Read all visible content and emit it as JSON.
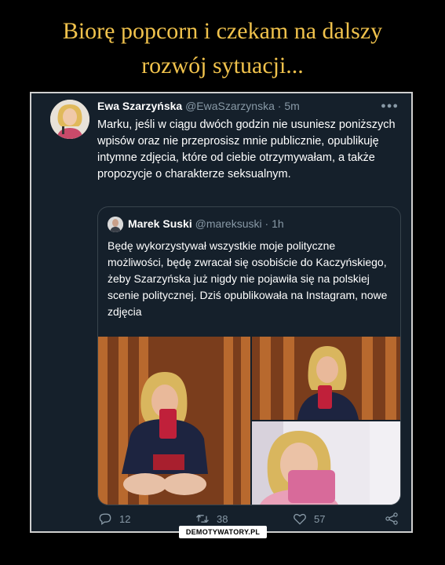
{
  "meme": {
    "title_line1": "Biorę popcorn i czekam na dalszy",
    "title_line2": "rozwój sytuacji...",
    "watermark": "DEMOTYWATORY.PL"
  },
  "tweet": {
    "name": "Ewa Szarzyńska",
    "handle": "@EwaSzarzynska",
    "separator": "·",
    "time": "5m",
    "text": "Marku, jeśli w ciągu dwóch godzin nie usuniesz poniższych wpisów oraz nie przeprosisz mnie publicznie, opublikuję intymne zdjęcia, które od ciebie otrzymywałam, a także propozycje o charakterze seksualnym."
  },
  "quoted_tweet": {
    "name": "Marek Suski",
    "handle": "@mareksuski",
    "separator": "·",
    "time": "1h",
    "text": "Będę wykorzystywał wszystkie moje polityczne możliwości, będę zwracał się osobiście do Kaczyńskiego, żeby Szarzyńska już nigdy nie pojawiła się na polskiej scenie politycznej. Dziś opublikowała na Instagram, nowe zdjęcia"
  },
  "actions": {
    "reply_count": "12",
    "retweet_count": "38",
    "like_count": "57"
  },
  "icons": [
    "more-icon",
    "reply-icon",
    "retweet-icon",
    "like-icon",
    "share-icon"
  ],
  "colors": {
    "title": "#f0c24c",
    "tweet_bg": "#15202b",
    "text": "#ffffff",
    "muted": "#8899a6",
    "border": "#38444d"
  }
}
